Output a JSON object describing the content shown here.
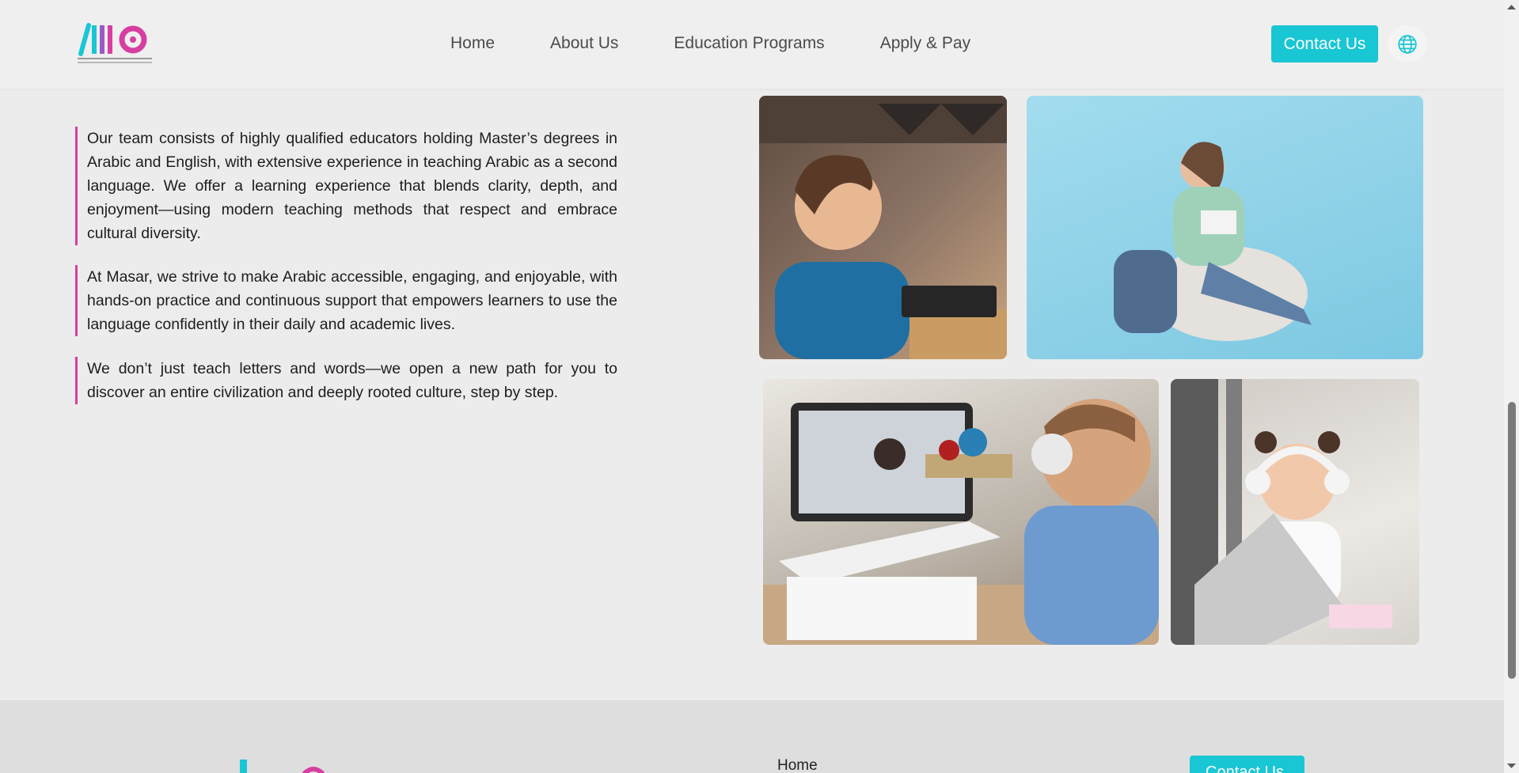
{
  "header": {
    "nav": [
      "Home",
      "About Us",
      "Education Programs",
      "Apply & Pay"
    ],
    "contact_label": "Contact Us"
  },
  "paragraphs": [
    "Our team consists of highly qualified educators holding Master’s degrees in Arabic and English, with extensive experience in teaching Arabic as a second language. We offer a learning experience that blends clarity, depth, and enjoyment—using modern teaching methods that respect and embrace cultural diversity.",
    "At Masar, we strive to make Arabic accessible, engaging, and enjoyable, with hands-on practice and continuous support that empowers learners to use the language confidently in their daily and academic lives.",
    "We don’t just teach letters and words—we open a new path for you to discover an entire civilization and deeply rooted culture, step by step."
  ],
  "images": [
    "boy-laptop-earbuds",
    "girl-beanbag-tablet",
    "boy-headphones-video-call",
    "girl-headphones-laptop"
  ],
  "footer": {
    "home": "Home",
    "contact_label": "Contact Us"
  },
  "colors": {
    "accent": "#19c6d3",
    "brand_pink": "#d63fa1"
  }
}
